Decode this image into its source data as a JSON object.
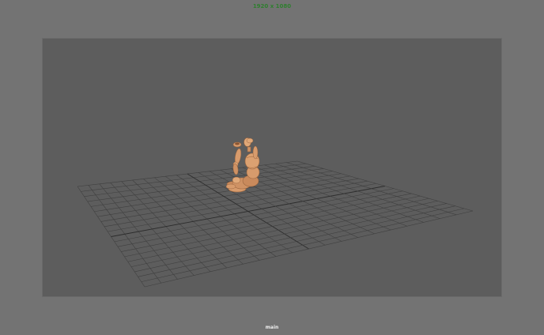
{
  "viewport": {
    "resolution_text": "1920 x 1080",
    "camera_name": "main"
  },
  "scene": {
    "objects": [
      {
        "name": "ground-grid",
        "kind": "grid"
      },
      {
        "name": "wooden-mannequin",
        "kind": "figure",
        "pose": "sitting, arms raised to head"
      }
    ],
    "colors": {
      "background": "#737373",
      "gate": "#5d5d5d",
      "grid_line": "#3f3f3f",
      "grid_axis": "#2c2c2c",
      "mannequin": "#d79b6c",
      "mannequin_shade": "#a66c42",
      "resolution_text": "#2f7f2f"
    }
  }
}
